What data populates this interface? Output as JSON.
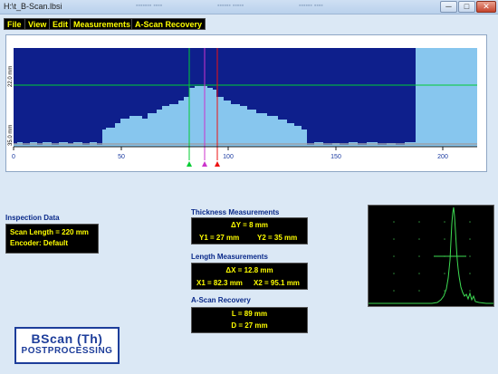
{
  "window": {
    "title": "H:\\t_B-Scan.lbsi",
    "minimize_glyph": "─",
    "maximize_glyph": "□",
    "close_glyph": "✕"
  },
  "menu": {
    "items": [
      "File",
      "View",
      "Edit",
      "Measurements",
      "A-Scan Recovery"
    ]
  },
  "bscan": {
    "x_ticks": [
      "0",
      "50",
      "100",
      "150",
      "200"
    ],
    "y_ticks": [
      "22.0 mm",
      "35.0 mm"
    ],
    "colors": {
      "background": "#0e1f8c",
      "profile": "#87c6ee",
      "green": "#00cc33",
      "magenta": "#cc33cc",
      "red": "#ee1111"
    }
  },
  "inspection": {
    "heading": "Inspection Data",
    "scan_length": "Scan Length = 220 mm",
    "encoder": "Encoder: Default"
  },
  "thickness": {
    "heading": "Thickness Measurements",
    "delta": "ΔY = 8 mm",
    "y1": "Y1 = 27 mm",
    "y2": "Y2 = 35 mm"
  },
  "length": {
    "heading": "Length Measurements",
    "delta": "ΔX = 12.8 mm",
    "x1": "X1 = 82.3 mm",
    "x2": "X2 = 95.1 mm"
  },
  "ascan_recovery": {
    "heading": "A-Scan Recovery",
    "l": "L = 89 mm",
    "d": "D = 27 mm"
  },
  "logo": {
    "line1": "BScan (Th)",
    "line2": "POSTPROCESSING"
  }
}
